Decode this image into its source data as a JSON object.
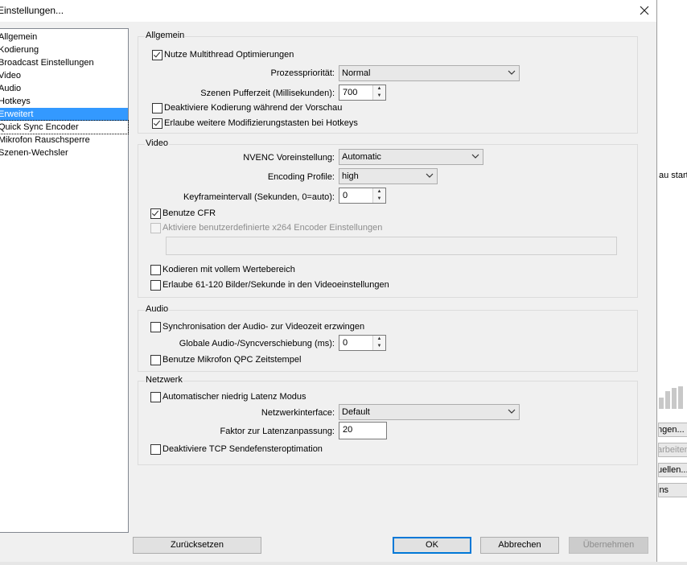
{
  "window": {
    "title": "Einstellungen..."
  },
  "sidebar": {
    "items": [
      {
        "label": "Allgemein"
      },
      {
        "label": "Kodierung"
      },
      {
        "label": "Broadcast Einstellungen"
      },
      {
        "label": "Video"
      },
      {
        "label": "Audio"
      },
      {
        "label": "Hotkeys"
      },
      {
        "label": "Erweitert"
      },
      {
        "label": "Quick Sync Encoder"
      },
      {
        "label": "Mikrofon Rauschsperre"
      },
      {
        "label": "Szenen-Wechsler"
      }
    ],
    "selected": "Erweitert"
  },
  "general": {
    "title": "Allgemein",
    "multithread": {
      "label": "Nutze Multithread Optimierungen",
      "checked": true
    },
    "priority": {
      "label": "Prozesspriorität:",
      "value": "Normal"
    },
    "buffer": {
      "label": "Szenen Pufferzeit (Millisekunden):",
      "value": "700"
    },
    "disable_preview_encoding": {
      "label": "Deaktiviere Kodierung während der Vorschau",
      "checked": false
    },
    "hotkey_modifiers": {
      "label": "Erlaube weitere Modifizierungstasten bei Hotkeys",
      "checked": true
    }
  },
  "video": {
    "title": "Video",
    "nvenc": {
      "label": "NVENC Voreinstellung:",
      "value": "Automatic"
    },
    "profile": {
      "label": "Encoding Profile:",
      "value": "high"
    },
    "keyframe": {
      "label": "Keyframeintervall (Sekunden, 0=auto):",
      "value": "0"
    },
    "cfr": {
      "label": "Benutze CFR",
      "checked": true
    },
    "custom_x264": {
      "label": "Aktiviere benutzerdefinierte x264 Encoder Einstellungen",
      "checked": false,
      "disabled": true
    },
    "custom_x264_value": "",
    "full_range": {
      "label": "Kodieren mit vollem Wertebereich",
      "checked": false
    },
    "high_fps": {
      "label": "Erlaube 61-120 Bilder/Sekunde in den Videoeinstellungen",
      "checked": false
    }
  },
  "audio": {
    "title": "Audio",
    "sync": {
      "label": "Synchronisation der Audio- zur Videozeit erzwingen",
      "checked": false
    },
    "offset": {
      "label": "Globale Audio-/Syncverschiebung (ms):",
      "value": "0"
    },
    "mic_qpc": {
      "label": "Benutze Mikrofon QPC Zeitstempel",
      "checked": false
    }
  },
  "network": {
    "title": "Netzwerk",
    "low_latency": {
      "label": "Automatischer niedrig Latenz Modus",
      "checked": false
    },
    "interface": {
      "label": "Netzwerkinterface:",
      "value": "Default"
    },
    "latency_factor": {
      "label": "Faktor zur Latenzanpassung:",
      "value": "20"
    },
    "disable_tcp": {
      "label": "Deaktiviere TCP Sendefensteroptimation",
      "checked": false
    }
  },
  "buttons": {
    "reset": "Zurücksetzen",
    "ok": "OK",
    "cancel": "Abbrechen",
    "apply": "Übernehmen"
  },
  "background_app": {
    "side_text": "au starte",
    "buttons": [
      "ngen...",
      "arbeiten",
      "uellen...",
      "ins"
    ]
  },
  "colors": {
    "selection": "#3399ff",
    "dialog_bg": "#f0f0f0",
    "default_button_border": "#0078d7"
  }
}
